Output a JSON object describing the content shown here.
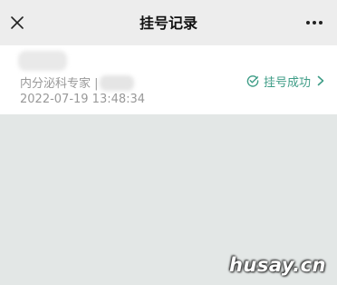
{
  "nav": {
    "title": "挂号记录",
    "close_icon": "close-icon",
    "more_icon": "more-horizontal-icon"
  },
  "record": {
    "department": "内分泌科专家 |",
    "time": "2022-07-19 13:48:34",
    "status": "挂号成功",
    "status_icon": "check-circle-icon",
    "status_color": "#3f9d87"
  },
  "watermark": "husay.cn"
}
